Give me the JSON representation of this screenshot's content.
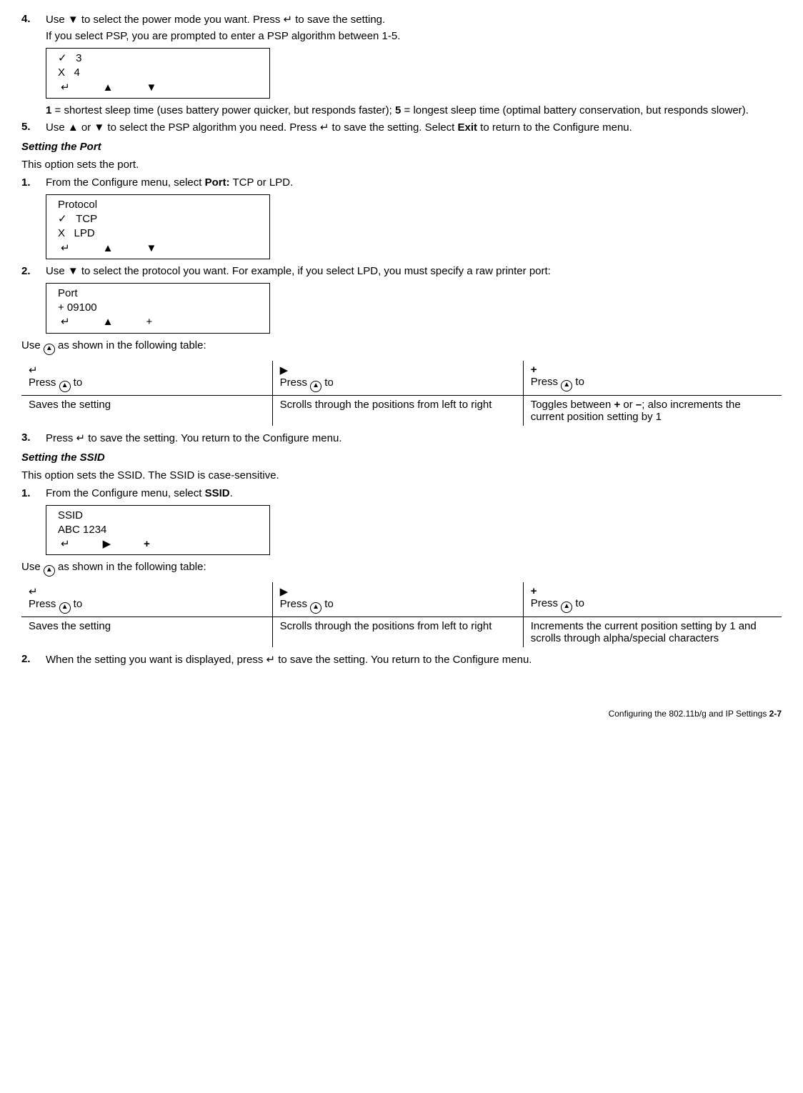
{
  "step4": {
    "num": "4.",
    "line1a": "Use ",
    "line1b": " to select the power mode you want.  Press ",
    "line1c": " to save the setting.",
    "line2": "If you select PSP, you are prompted to enter a PSP algorithm between 1-5."
  },
  "box1": {
    "r1a": "✓",
    "r1b": "3",
    "r2a": "X",
    "r2b": "4",
    "navA": "↵",
    "navB": "▲",
    "navC": "▼"
  },
  "step4_after": {
    "a": "1",
    "b": " = shortest sleep time (uses battery power quicker, but responds faster); ",
    "c": "5",
    "d": " = longest sleep time (optimal battery conservation, but responds slower)."
  },
  "step5": {
    "num": "5.",
    "a": "Use ",
    "b": " or ",
    "c": " to select the PSP algorithm you need.  Press ",
    "d": " to save the setting.  Select ",
    "e": "Exit",
    "f": " to return to the Configure menu."
  },
  "heading_port": "Setting the Port",
  "port_intro": "This option sets the port.",
  "port_step1": {
    "num": "1.",
    "a": "From the Configure menu, select ",
    "b": "Port:",
    "c": " TCP or LPD."
  },
  "box2": {
    "title": "Protocol",
    "r1a": "✓",
    "r1b": "TCP",
    "r2a": "X",
    "r2b": "LPD",
    "navA": "↵",
    "navB": "▲",
    "navC": "▼"
  },
  "port_step2": {
    "num": "2.",
    "a": "Use ",
    "b": " to select the protocol you want.  For example, if you select LPD, you must specify a raw printer port:"
  },
  "box3": {
    "title": "Port",
    "val": "+ 09100",
    "navA": "↵",
    "navB": "▲",
    "navC": "+"
  },
  "use_table_intro": "Use ",
  "use_table_intro2": " as shown in the following table:",
  "circle_glyph": "▲",
  "table1": {
    "h1a": "↵",
    "h1b": "Press ",
    "h1c": " to",
    "h2a": "▶",
    "h2b": "Press ",
    "h2c": " to",
    "h3a": "+",
    "h3b": "Press ",
    "h3c": " to",
    "r1": "Saves the setting",
    "r2": "Scrolls through the positions from left to right",
    "r3a": "Toggles between ",
    "r3b": "+",
    "r3c": " or ",
    "r3d": "–",
    "r3e": "; also increments the current position setting by 1"
  },
  "port_step3": {
    "num": "3.",
    "a": "Press ",
    "b": " to save the setting.  You return to the Configure menu."
  },
  "heading_ssid": "Setting the SSID",
  "ssid_intro": "This option sets the SSID.  The SSID is case-sensitive.",
  "ssid_step1": {
    "num": "1.",
    "a": "From the Configure menu, select ",
    "b": "SSID",
    "c": "."
  },
  "box4": {
    "title": "SSID",
    "val": "ABC 1234",
    "navA": "↵",
    "navB": "▶",
    "navC": "+"
  },
  "table2": {
    "h1a": "↵",
    "h1b": "Press ",
    "h1c": " to",
    "h2a": "▶",
    "h2b": "Press ",
    "h2c": " to",
    "h3a": "+",
    "h3b": "Press ",
    "h3c": " to",
    "r1": "Saves the setting",
    "r2": "Scrolls through the positions from left to right",
    "r3": "Increments the current position setting by 1 and scrolls through alpha/special characters"
  },
  "ssid_step2": {
    "num": "2.",
    "a": "When the setting you want is displayed, press ",
    "b": " to save the setting.  You return to the Configure menu."
  },
  "footer": {
    "a": "Configuring the 802.11b/g and IP Settings  ",
    "b": "2-7"
  },
  "glyphs": {
    "down": "▼",
    "up": "▲",
    "enter": "↵",
    "right": "▶"
  }
}
